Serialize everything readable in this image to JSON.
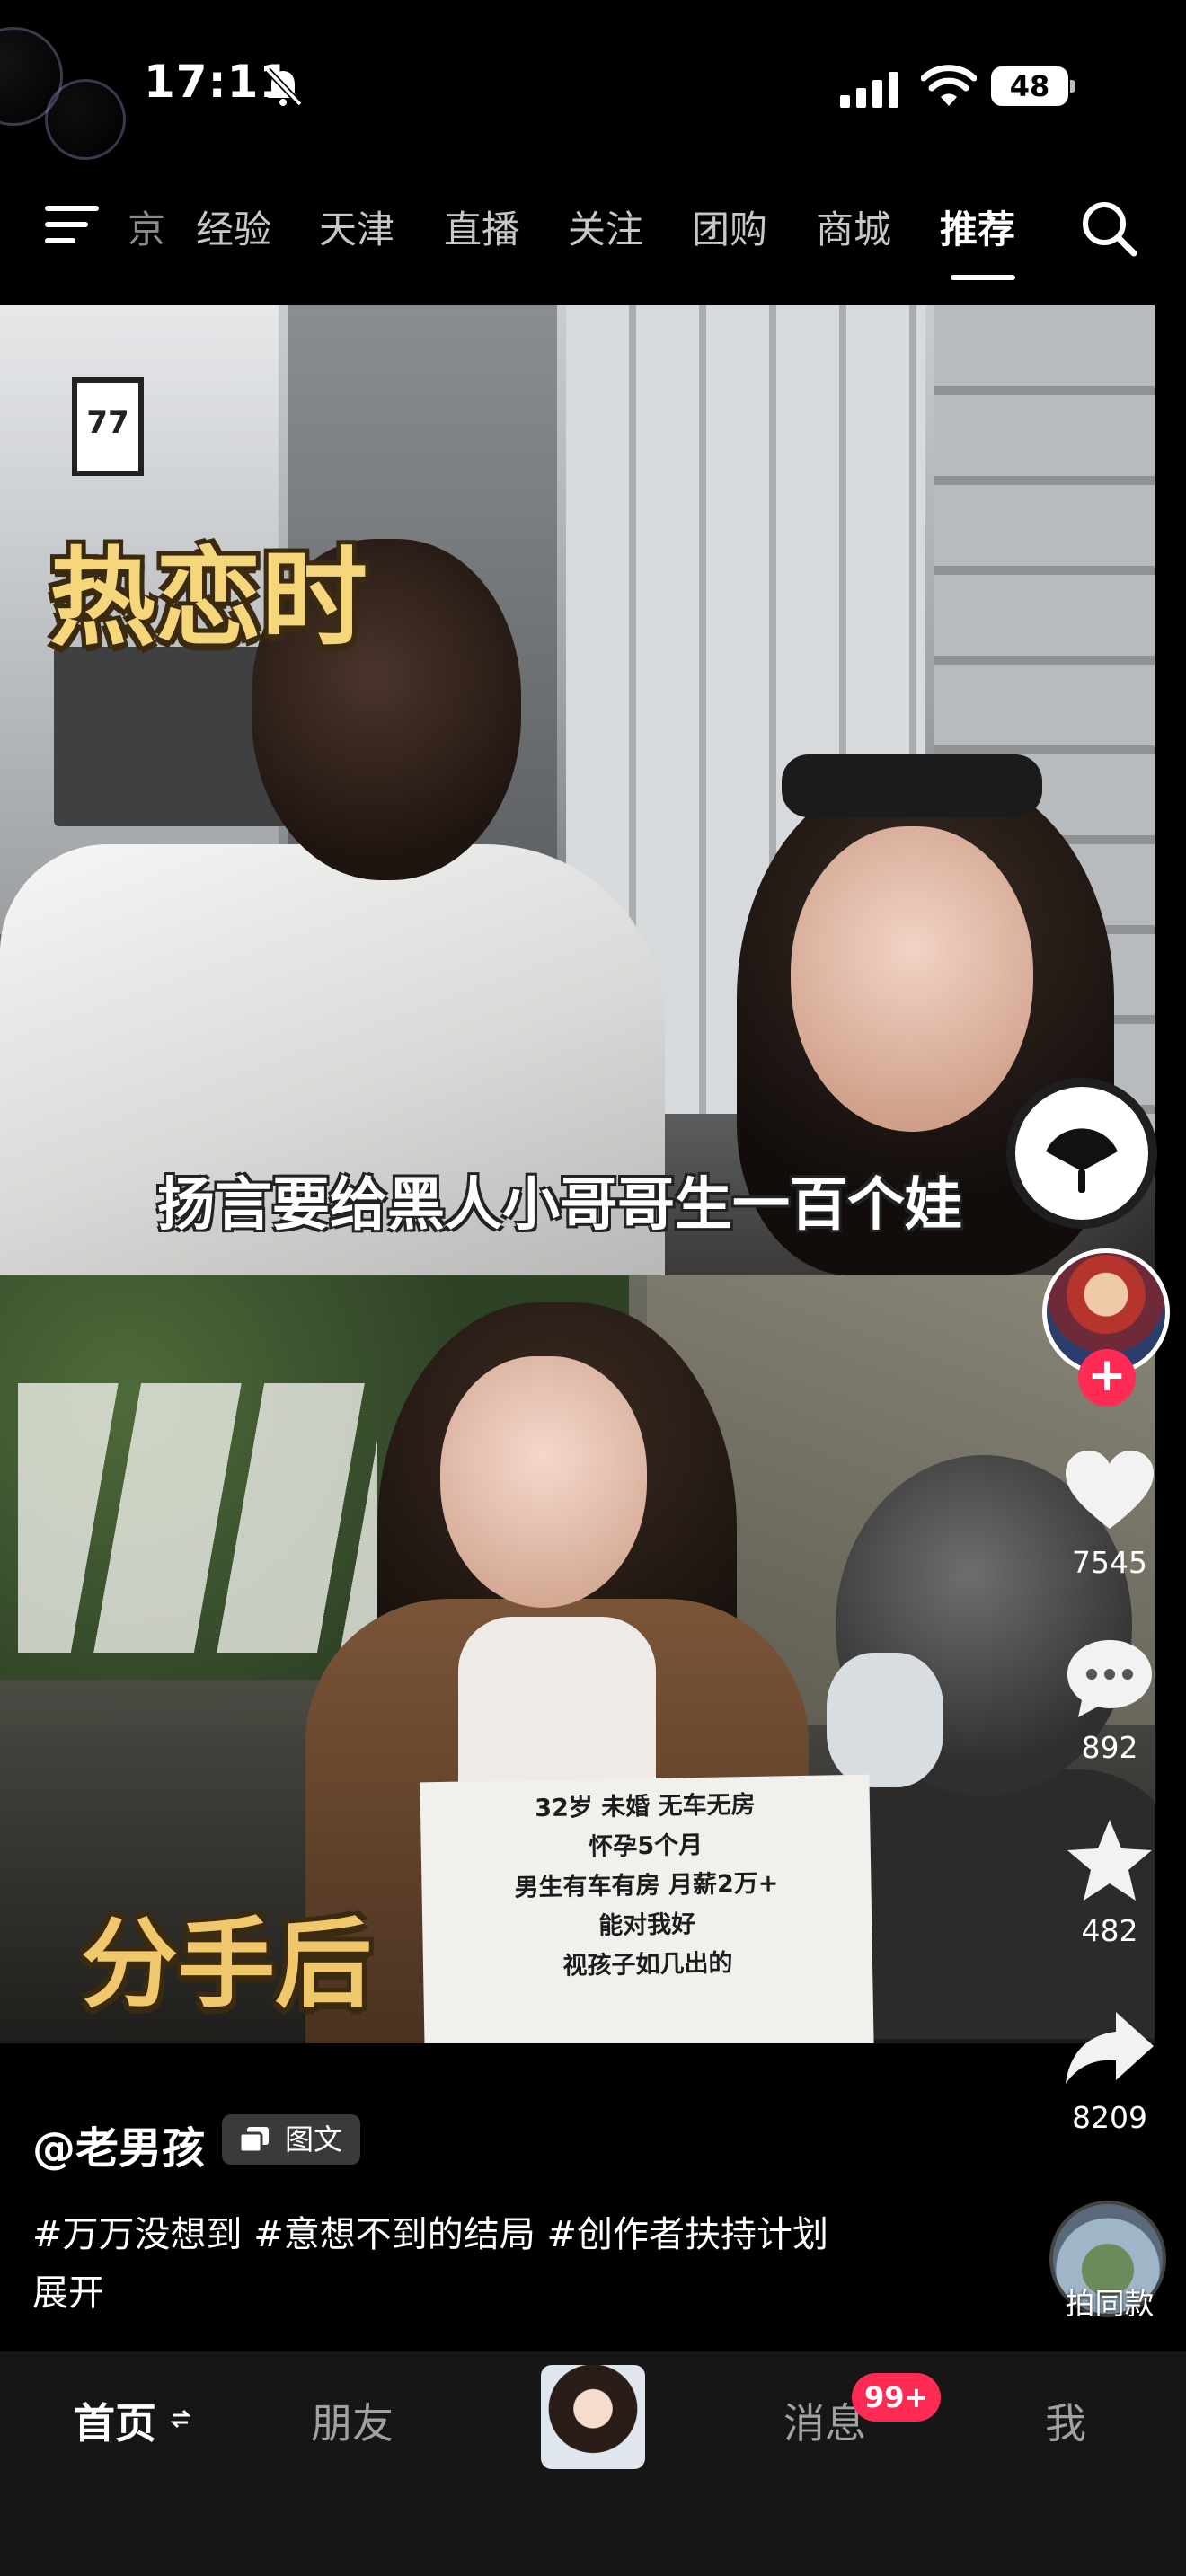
{
  "status_bar": {
    "time": "17:11",
    "battery_level": "48",
    "icons": [
      "bell-slash-icon",
      "cellular-signal-icon",
      "wifi-icon",
      "battery-icon"
    ]
  },
  "top_nav": {
    "tabs": [
      "京",
      "经验",
      "天津",
      "直播",
      "关注",
      "团购",
      "商城",
      "推荐"
    ],
    "active_tab": "推荐",
    "icons": [
      "menu-icon",
      "search-icon"
    ]
  },
  "video": {
    "caption_top": "热恋时",
    "caption_middle": "扬言要给黑人小哥哥生一百个娃",
    "caption_bottom": "分手后",
    "store_sign": "77",
    "paper_sign": [
      "32岁 未婚 无车无房",
      "怀孕5个月",
      "男生有车有房 月薪2万+",
      "能对我好",
      "视孩子如几出的"
    ]
  },
  "right_rail": {
    "likes": "7545",
    "comments": "892",
    "favorites": "482",
    "shares": "8209",
    "same_style_label": "拍同款",
    "icons": [
      "fan-disc-icon",
      "heart-icon",
      "comment-icon",
      "star-icon",
      "share-icon",
      "plus-icon"
    ]
  },
  "post": {
    "author": "@老男孩",
    "type_tag": "图文",
    "hashtags": "#万万没想到 #意想不到的结局 #创作者扶持计划",
    "expand": "展开"
  },
  "bottom_tabs": {
    "home": "首页",
    "friends": "朋友",
    "messages": "消息",
    "messages_badge": "99+",
    "me": "我"
  },
  "colors": {
    "accent": "#fe2c55",
    "caption_yellow": "#f6d67a",
    "tabbar_bg": "#161616"
  }
}
